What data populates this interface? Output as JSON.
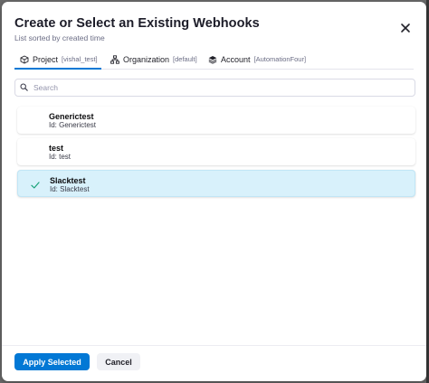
{
  "dialog": {
    "title": "Create or Select an Existing Webhooks",
    "subtitle": "List sorted by created time"
  },
  "tabs": [
    {
      "label": "Project",
      "scope": "[vishal_test]",
      "icon": "cube-icon",
      "active": true
    },
    {
      "label": "Organization",
      "scope": "[default]",
      "icon": "hierarchy-icon",
      "active": false
    },
    {
      "label": "Account",
      "scope": "[AutomationFour]",
      "icon": "layers-icon",
      "active": false
    }
  ],
  "search": {
    "placeholder": "Search",
    "value": ""
  },
  "webhooks": [
    {
      "name": "Generictest",
      "id": "Id: Generictest",
      "selected": false
    },
    {
      "name": "test",
      "id": "Id: test",
      "selected": false
    },
    {
      "name": "Slacktest",
      "id": "Id: Slacktest",
      "selected": true
    }
  ],
  "footer": {
    "apply_label": "Apply Selected",
    "cancel_label": "Cancel"
  },
  "colors": {
    "primary": "#0278d5",
    "selected_bg": "#d8f1fb",
    "check": "#1aa37a"
  }
}
